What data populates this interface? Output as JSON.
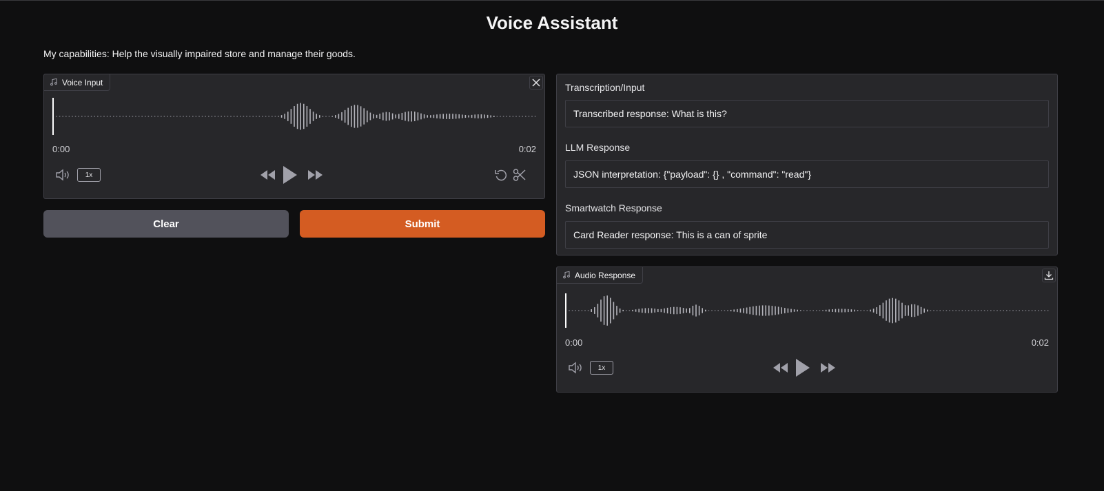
{
  "app": {
    "title": "Voice Assistant",
    "capabilities": "My capabilities: Help the visually impaired store and manage their goods."
  },
  "voice_input": {
    "label": "Voice Input",
    "time_start": "0:00",
    "time_end": "0:02",
    "rate": "1x",
    "icons": [
      "music-note-icon",
      "close-icon",
      "volume-icon",
      "rewind-icon",
      "play-icon",
      "fast-forward-icon",
      "undo-icon",
      "scissors-icon"
    ]
  },
  "actions": {
    "clear_label": "Clear",
    "submit_label": "Submit",
    "clear_color": "#52525b",
    "submit_color": "#d45c22"
  },
  "outputs": {
    "transcription": {
      "label": "Transcription/Input",
      "value": "Transcribed response:  What is this?"
    },
    "llm": {
      "label": "LLM Response",
      "value": "JSON interpretation: {\"payload\": {} , \"command\": \"read\"}"
    },
    "smartwatch": {
      "label": "Smartwatch Response",
      "value": "Card Reader response: This is a can of sprite"
    }
  },
  "audio_response": {
    "label": "Audio Response",
    "time_start": "0:00",
    "time_end": "0:02",
    "rate": "1x",
    "icons": [
      "music-note-icon",
      "download-icon",
      "volume-icon",
      "rewind-icon",
      "play-icon",
      "fast-forward-icon"
    ]
  }
}
